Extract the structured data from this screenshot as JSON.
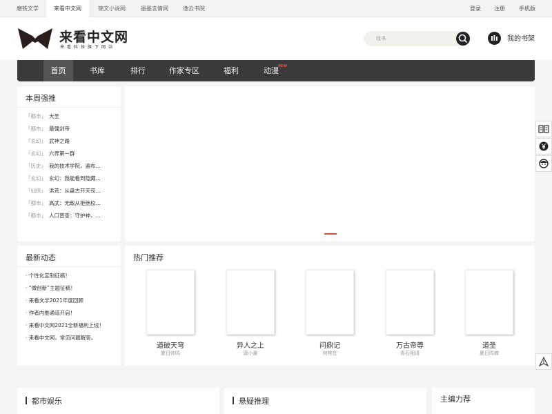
{
  "topbar": {
    "sites": [
      "磨铁文学",
      "来看中文网",
      "锦文小说网",
      "墨墨言情网",
      "逸云书院"
    ],
    "login": "登录",
    "register": "注册",
    "mobile": "手机版"
  },
  "header": {
    "logo_title": "来看中文网",
    "logo_sub": "来看科技旗下网站",
    "search_placeholder": "找书",
    "shelf": "我的书架"
  },
  "nav": {
    "items": [
      "首页",
      "书库",
      "排行",
      "作家专区",
      "福利",
      "动漫"
    ],
    "new_badge": "NEW"
  },
  "weekly": {
    "title": "本周强推",
    "items": [
      {
        "cat": "「都市」",
        "name": "大圣"
      },
      {
        "cat": "「都市」",
        "name": "最强剑帝"
      },
      {
        "cat": "「玄幻」",
        "name": "武神之路"
      },
      {
        "cat": "「玄幻」",
        "name": "六界第一群"
      },
      {
        "cat": "「历史」",
        "name": "我的技术学院，遍布..."
      },
      {
        "cat": "「玄幻」",
        "name": "玄幻：我能看到隐藏..."
      },
      {
        "cat": "「仙侠」",
        "name": "洪荒：从盘古开天苟..."
      },
      {
        "cat": "「都市」",
        "name": "高武：无敌从拒绝校..."
      },
      {
        "cat": "「都市」",
        "name": "人口普查：守护神，..."
      }
    ]
  },
  "news": {
    "title": "最新动态",
    "items": [
      "· 个性化定制征稿！",
      "· “微创新”主题征稿！",
      "· 来看文学2021年度回顾",
      "· 作者内推通道开启！",
      "· 来看中文网2021全新福利上线！",
      "· 来看中文网，常见问题解答。"
    ]
  },
  "hot": {
    "title": "热门推荐",
    "books": [
      {
        "title": "道破天穹",
        "author": "夏日帅鸣"
      },
      {
        "title": "异人之上",
        "author": "唐小豪"
      },
      {
        "title": "问鼎记",
        "author": "何常在"
      },
      {
        "title": "万古帝尊",
        "author": "青石细语"
      },
      {
        "title": "道圣",
        "author": "夏日鸣蝉"
      }
    ]
  },
  "sections": {
    "urban": "都市娱乐",
    "mystery": "悬疑推理",
    "editor": "主编力荐"
  },
  "icons": {
    "search": "search-icon",
    "shelf": "bookshelf-icon",
    "side": [
      "book-icon",
      "yen-coin-icon",
      "customer-service-icon",
      "back-to-top-icon"
    ]
  }
}
